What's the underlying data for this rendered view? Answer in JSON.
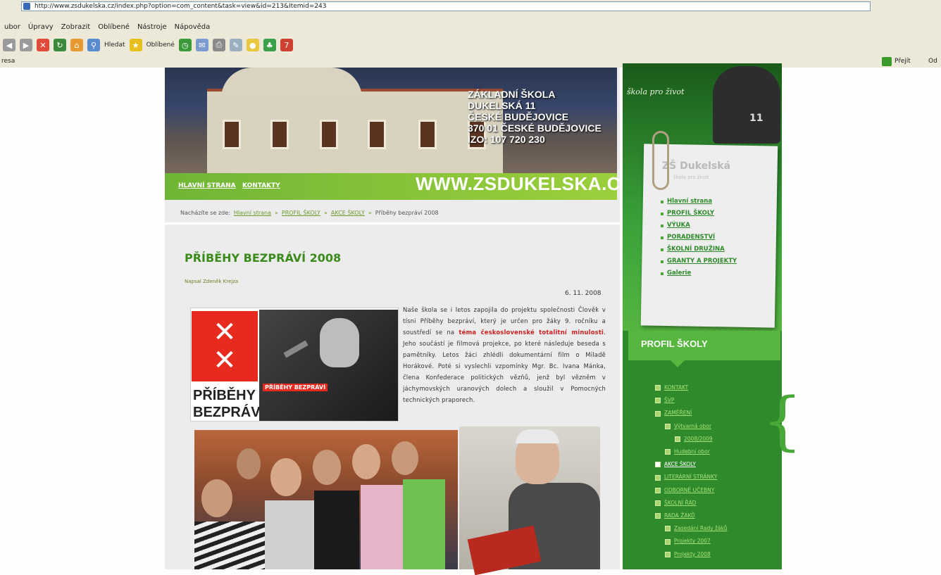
{
  "browser": {
    "menu": [
      "ubor",
      "Úpravy",
      "Zobrazit",
      "Oblíbené",
      "Nástroje",
      "Nápověda"
    ],
    "toolbar": {
      "search_label": "Hledat",
      "favorites_label": "Oblíbené"
    },
    "address_label": "resa",
    "url": "http://www.zsdukelska.cz/index.php?option=com_content&task=view&id=213&Itemid=243",
    "go_label": "Přejít",
    "links_label": "Od"
  },
  "banner": {
    "school_lines": [
      "ZÁKLADNÍ ŠKOLA",
      "DUKELSKÁ 11",
      "ČESKÉ BUDĚJOVICE",
      "370 01 ČESKÉ BUDĚJOVICE",
      "IZO: 107 720 230"
    ],
    "site_url": "WWW.ZSDUKELSKA.CZ/",
    "nav": [
      "HLAVNÍ STRANA",
      "KONTAKTY"
    ]
  },
  "breadcrumb": {
    "prefix": "Nacházíte se zde:",
    "items": [
      "Hlavní strana",
      "PROFIL ŠKOLY",
      "AKCE ŠKOLY"
    ],
    "current": "Příběhy bezpráví 2008"
  },
  "article": {
    "title": "PŘÍBĚHY BEZPRÁVÍ 2008",
    "author": "Napsal Zdeněk Krejza",
    "date": "6. 11. 2008",
    "body_before": "Naše škola se i letos zapojila do projektu společnosti Člověk v tísni Příběhy bezpráví, který je určen pro žáky 9. ročníku a soustředí se na ",
    "body_highlight": "téma československé totalitní minulosti",
    "body_after": ". Jeho součástí je filmová projekce, po které následuje beseda s pamětníky. Letos žáci zhlédli dokumentární film o Miladě Horákové. Poté si vyslechli vzpomínky Mgr. Bc. Ivana Mánka, člena Konfederace politických vězňů, jenž byl vězněm v jáchymovských uranových dolech a sloužil v Pomocných technických praporech.",
    "poster_text": [
      "PŘÍBĚHY",
      "BEZPRÁVÍ"
    ],
    "poster_label": "PŘÍBĚHY BEZPRÁVÍ"
  },
  "sidebar": {
    "slogan": "škola pro život",
    "jersey_number": "11",
    "logo_text": "ZŠ Dukelská",
    "logo_sub": "škola pro život",
    "main_menu": [
      "Hlavní strana",
      "PROFIL ŠKOLY",
      "VÝUKA",
      "PORADENSTVÍ",
      "ŠKOLNÍ DRUŽINA",
      "GRANTY A PROJEKTY",
      "Galerie"
    ],
    "section_title": "PROFIL ŠKOLY",
    "profil_menu": [
      {
        "label": "KONTAKT",
        "indent": 0,
        "active": false
      },
      {
        "label": "ŠVP",
        "indent": 0,
        "active": false
      },
      {
        "label": "ZAMĚŘENÍ",
        "indent": 0,
        "active": false
      },
      {
        "label": "Výtvarná obor",
        "indent": 1,
        "active": false
      },
      {
        "label": "2008/2009",
        "indent": 2,
        "active": false
      },
      {
        "label": "Hudební obor",
        "indent": 1,
        "active": false
      },
      {
        "label": "AKCE ŠKOLY",
        "indent": 0,
        "active": true
      },
      {
        "label": "LITERÁRNÍ STRÁNKY",
        "indent": 0,
        "active": false
      },
      {
        "label": "ODBORNÉ UČEBNY",
        "indent": 0,
        "active": false
      },
      {
        "label": "ŠKOLNÍ ŘÁD",
        "indent": 0,
        "active": false
      },
      {
        "label": "RADA ŽÁKŮ",
        "indent": 0,
        "active": false
      },
      {
        "label": "Zasedání Rady žáků",
        "indent": 1,
        "active": false
      },
      {
        "label": "Projekty 2007",
        "indent": 1,
        "active": false
      },
      {
        "label": "Projekty 2008",
        "indent": 1,
        "active": false
      }
    ]
  }
}
